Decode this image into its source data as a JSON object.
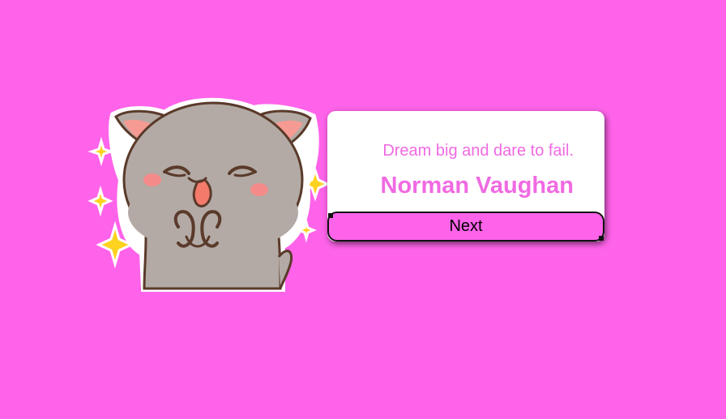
{
  "quote": {
    "text": "Dream big and dare to fail.",
    "author": "Norman Vaughan"
  },
  "controls": {
    "next_label": "Next"
  },
  "mascot": {
    "icon": "cat-sticker-icon",
    "sparkle_icon": "sparkle-icon"
  },
  "colors": {
    "background": "#ff63ea",
    "quote_text": "#f06ae2",
    "card": "#ffffff",
    "sparkle": "#ffd21f"
  }
}
